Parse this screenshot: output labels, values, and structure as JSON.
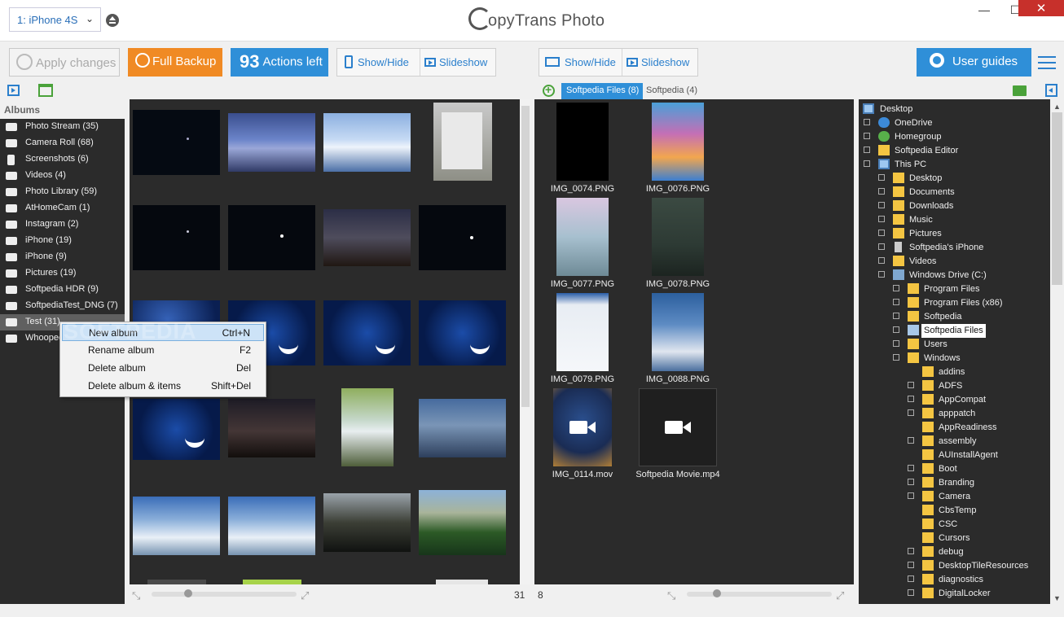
{
  "device_select": "1: iPhone 4S",
  "app_title": "opyTrans Photo",
  "window": {
    "minimize": "—",
    "maximize": "☐",
    "close": "✕"
  },
  "toolbar": {
    "apply_label": "Apply changes",
    "backup_label": "Full Backup",
    "actions_count": "93",
    "actions_label": "Actions left",
    "left_showhide": "Show/Hide",
    "left_slideshow": "Slideshow",
    "right_showhide": "Show/Hide",
    "right_slideshow": "Slideshow",
    "guides_label": "User guides"
  },
  "albums": {
    "header": "Albums",
    "items": [
      "Photo Stream (35)",
      "Camera Roll (68)",
      "Screenshots (6)",
      "Videos (4)",
      "Photo Library (59)",
      "AtHomeCam (1)",
      "Instagram (2)",
      "iPhone (19)",
      "iPhone (9)",
      "Pictures (19)",
      "Softpedia HDR (9)",
      "SoftpediaTest_DNG (7)",
      "Test (31)",
      "Whoopee"
    ]
  },
  "context_menu": {
    "items": [
      {
        "label": "New album",
        "shortcut": "Ctrl+N"
      },
      {
        "label": "Rename album",
        "shortcut": "F2"
      },
      {
        "label": "Delete album",
        "shortcut": "Del"
      },
      {
        "label": "Delete album & items",
        "shortcut": "Shift+Del"
      }
    ]
  },
  "watermark": "SOFTPEDIA",
  "left_footer": {
    "count": "31"
  },
  "device_panel": {
    "tab_active": "Softpedia Files (8)",
    "tab_inactive": "Softpedia (4)",
    "files": [
      "IMG_0074.PNG",
      "IMG_0076.PNG",
      "IMG_0077.PNG",
      "IMG_0078.PNG",
      "IMG_0079.PNG",
      "IMG_0088.PNG",
      "IMG_0114.mov",
      "Softpedia Movie.mp4"
    ],
    "count": "8"
  },
  "folder_tree": {
    "nodes": [
      "Desktop",
      "OneDrive",
      "Homegroup",
      "Softpedia Editor",
      "This PC",
      "Desktop",
      "Documents",
      "Downloads",
      "Music",
      "Pictures",
      "Softpedia's iPhone",
      "Videos",
      "Windows Drive (C:)",
      "Program Files",
      "Program Files (x86)",
      "Softpedia",
      "Softpedia Files",
      "Users",
      "Windows",
      "addins",
      "ADFS",
      "AppCompat",
      "apppatch",
      "AppReadiness",
      "assembly",
      "AUInstallAgent",
      "Boot",
      "Branding",
      "Camera",
      "CbsTemp",
      "CSC",
      "Cursors",
      "debug",
      "DesktopTileResources",
      "diagnostics",
      "DigitalLocker"
    ]
  },
  "colors": {
    "accent_blue": "#2f8fd8",
    "backup_orange": "#f08a24",
    "panel_dark": "#2b2b2b",
    "green": "#4aa23a"
  }
}
